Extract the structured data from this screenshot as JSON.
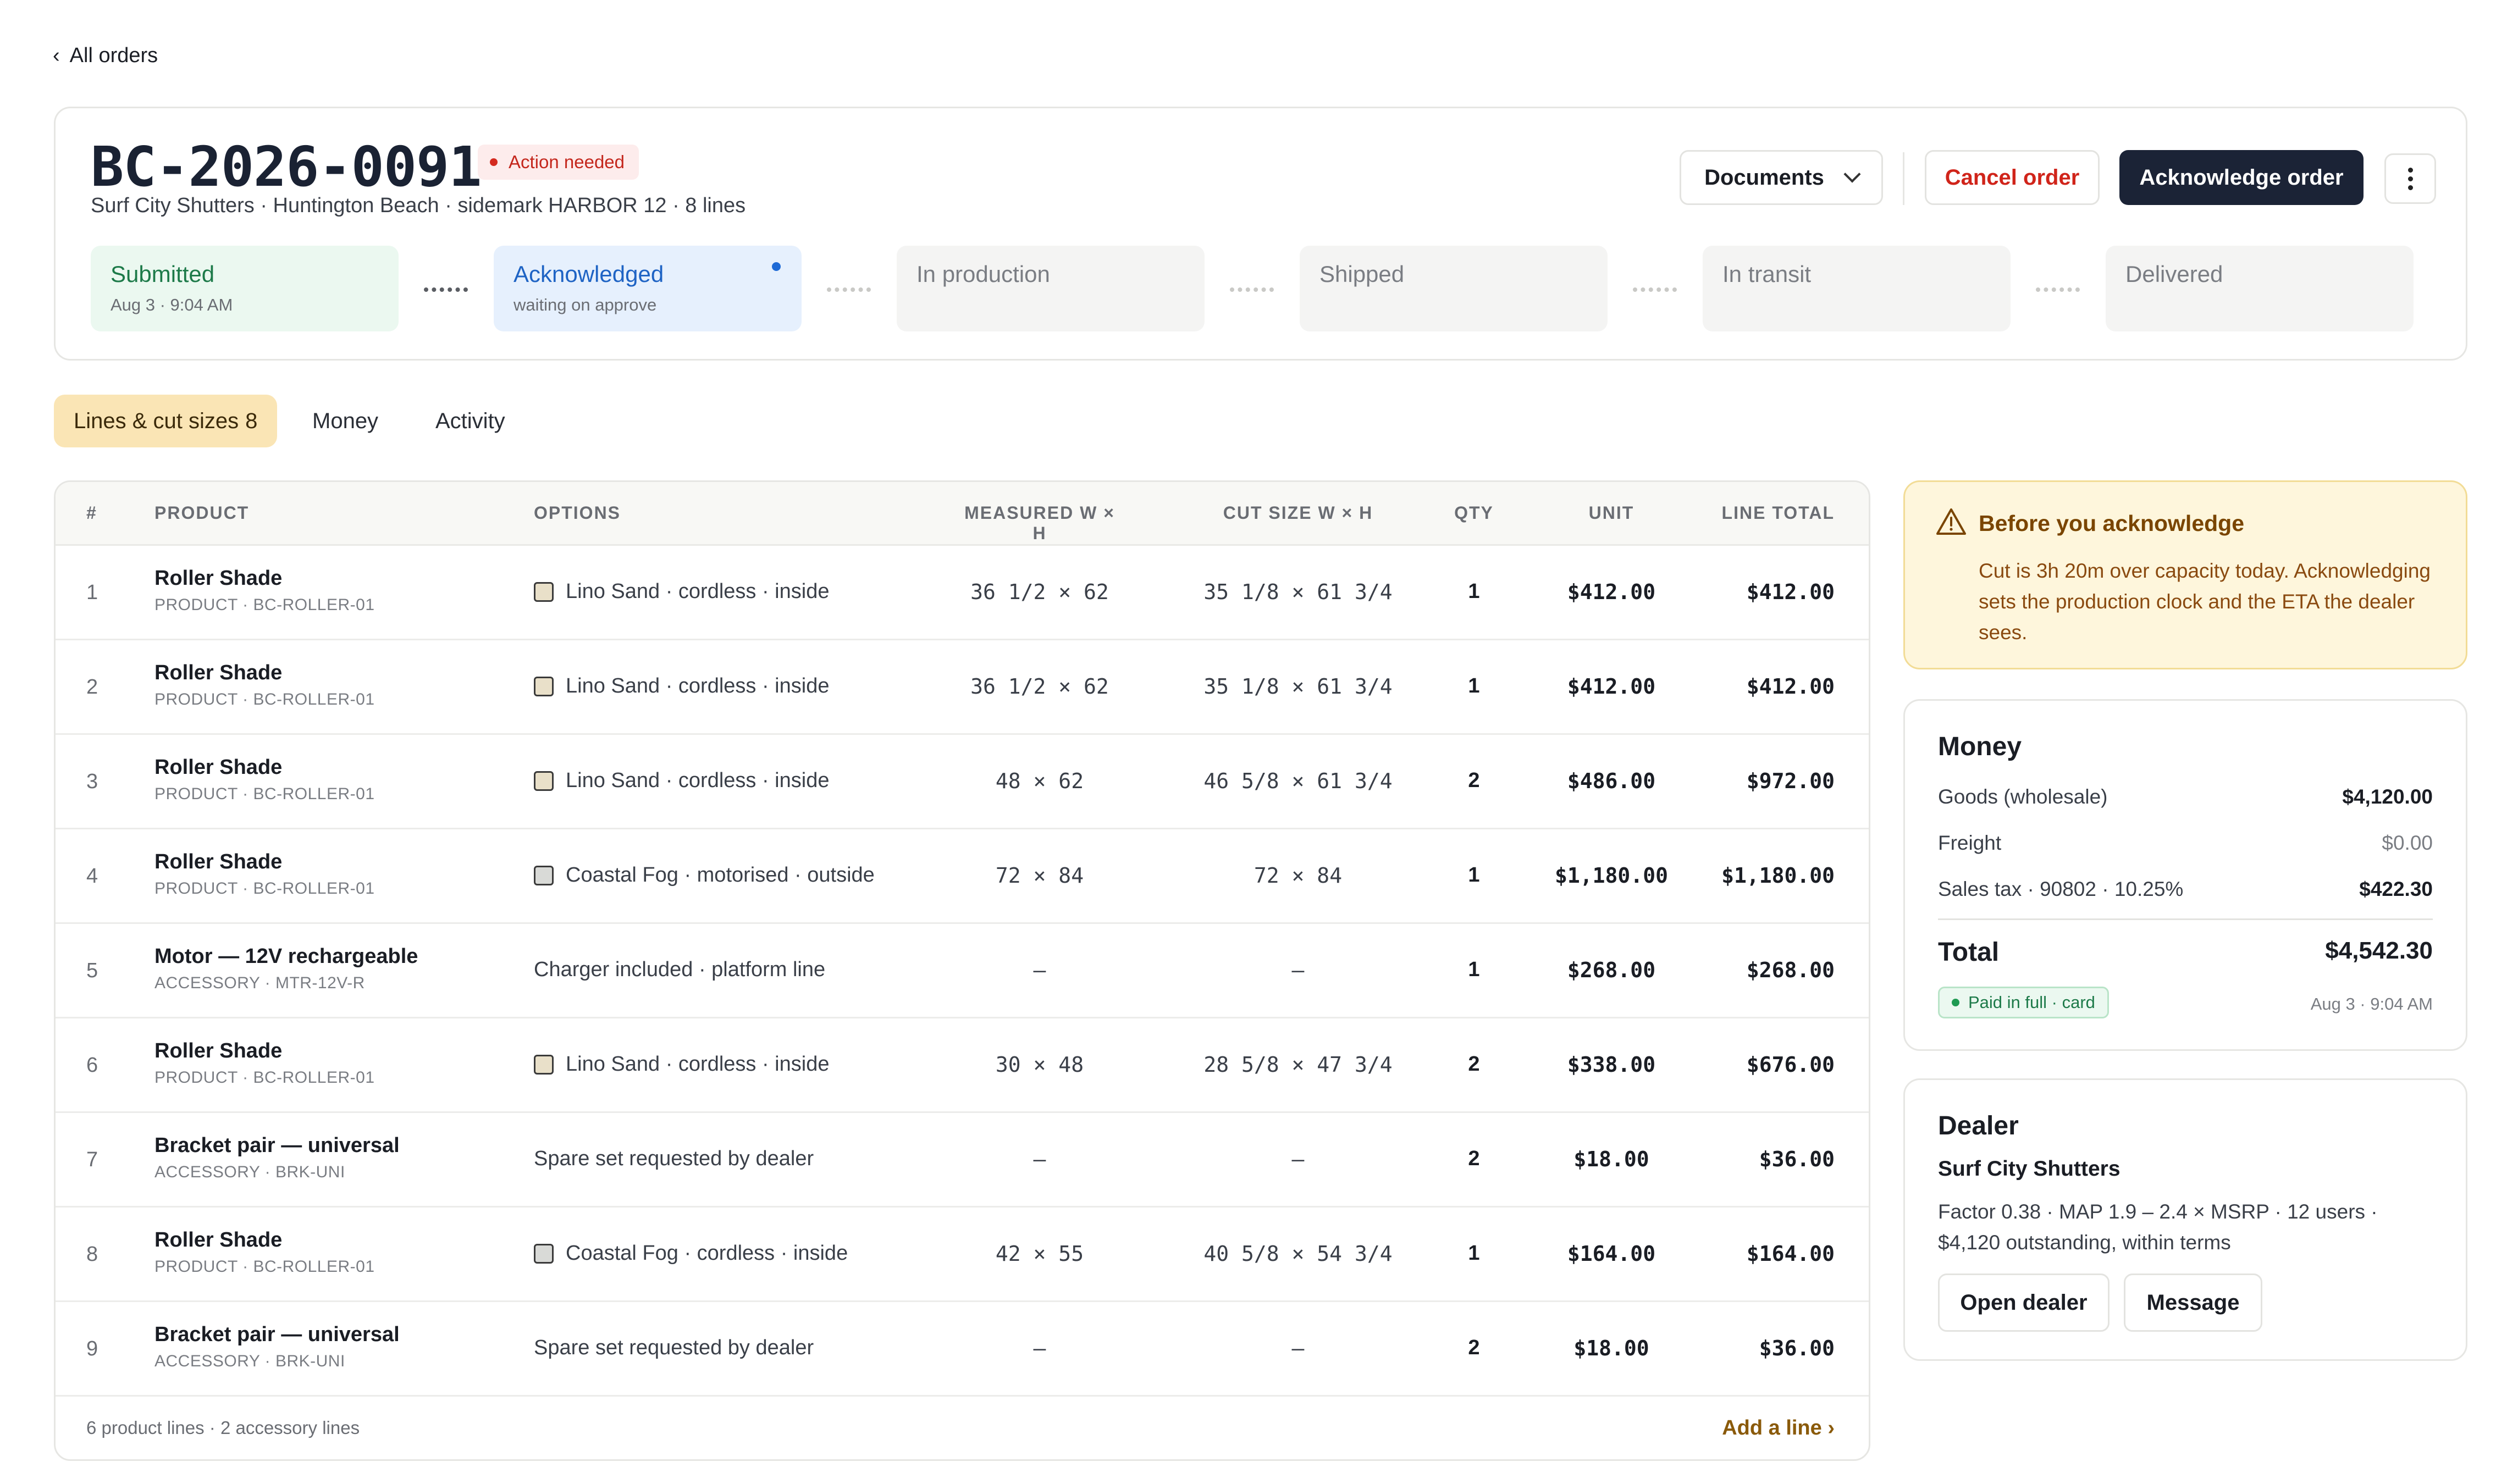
{
  "nav": {
    "back_label": "All orders"
  },
  "order": {
    "id": "BC-2026-0091",
    "status_badge": "Action needed",
    "subline": "Surf City Shutters · Huntington Beach · sidemark HARBOR 12 · 8 lines"
  },
  "actions": {
    "documents": "Documents",
    "cancel": "Cancel order",
    "acknowledge": "Acknowledge order"
  },
  "stepper": [
    {
      "label": "Submitted",
      "sub": "Aug 3 · 9:04 AM",
      "state": "done"
    },
    {
      "label": "Acknowledged",
      "sub": "waiting on approve",
      "state": "active"
    },
    {
      "label": "In production",
      "sub": "",
      "state": "pending"
    },
    {
      "label": "Shipped",
      "sub": "",
      "state": "pending"
    },
    {
      "label": "In transit",
      "sub": "",
      "state": "pending"
    },
    {
      "label": "Delivered",
      "sub": "",
      "state": "pending"
    }
  ],
  "tabs": [
    {
      "label": "Lines & cut sizes",
      "count": "8"
    },
    {
      "label": "Money",
      "count": ""
    },
    {
      "label": "Activity",
      "count": ""
    }
  ],
  "table": {
    "columns": [
      "#",
      "PRODUCT",
      "OPTIONS",
      "MEASURED W × H",
      "CUT SIZE W × H",
      "QTY",
      "UNIT",
      "LINE TOTAL"
    ],
    "rows": [
      {
        "num": "1",
        "name": "Roller Shade",
        "sku": "PRODUCT · BC-ROLLER-01",
        "options": "Lino Sand · cordless · inside",
        "swatch": "#e9e0c9",
        "measured": "36 1/2 × 62",
        "cut": "35 1/8 × 61 3/4",
        "qty": "1",
        "unit": "$412.00",
        "total": "$412.00"
      },
      {
        "num": "2",
        "name": "Roller Shade",
        "sku": "PRODUCT · BC-ROLLER-01",
        "options": "Lino Sand · cordless · inside",
        "swatch": "#e9e0c9",
        "measured": "36 1/2 × 62",
        "cut": "35 1/8 × 61 3/4",
        "qty": "1",
        "unit": "$412.00",
        "total": "$412.00"
      },
      {
        "num": "3",
        "name": "Roller Shade",
        "sku": "PRODUCT · BC-ROLLER-01",
        "options": "Lino Sand · cordless · inside",
        "swatch": "#e9e0c9",
        "measured": "48 × 62",
        "cut": "46 5/8 × 61 3/4",
        "qty": "2",
        "unit": "$486.00",
        "total": "$972.00"
      },
      {
        "num": "4",
        "name": "Roller Shade",
        "sku": "PRODUCT · BC-ROLLER-01",
        "options": "Coastal Fog · motorised · outside",
        "swatch": "#d9dad7",
        "measured": "72 × 84",
        "cut": "72 × 84",
        "qty": "1",
        "unit": "$1,180.00",
        "total": "$1,180.00"
      },
      {
        "num": "5",
        "name": "Motor — 12V rechargeable",
        "sku": "ACCESSORY · MTR-12V-R",
        "options": "Charger included · platform line",
        "swatch": "",
        "measured": "–",
        "cut": "–",
        "qty": "1",
        "unit": "$268.00",
        "total": "$268.00"
      },
      {
        "num": "6",
        "name": "Roller Shade",
        "sku": "PRODUCT · BC-ROLLER-01",
        "options": "Lino Sand · cordless · inside",
        "swatch": "#e9e0c9",
        "measured": "30 × 48",
        "cut": "28 5/8 × 47 3/4",
        "qty": "2",
        "unit": "$338.00",
        "total": "$676.00"
      },
      {
        "num": "7",
        "name": "Bracket pair — universal",
        "sku": "ACCESSORY · BRK-UNI",
        "options": "Spare set requested by dealer",
        "swatch": "",
        "measured": "–",
        "cut": "–",
        "qty": "2",
        "unit": "$18.00",
        "total": "$36.00"
      },
      {
        "num": "8",
        "name": "Roller Shade",
        "sku": "PRODUCT · BC-ROLLER-01",
        "options": "Coastal Fog · cordless · inside",
        "swatch": "#d9dad7",
        "measured": "42 × 55",
        "cut": "40 5/8 × 54 3/4",
        "qty": "1",
        "unit": "$164.00",
        "total": "$164.00"
      },
      {
        "num": "9",
        "name": "Bracket pair — universal",
        "sku": "ACCESSORY · BRK-UNI",
        "options": "Spare set requested by dealer",
        "swatch": "",
        "measured": "–",
        "cut": "–",
        "qty": "2",
        "unit": "$18.00",
        "total": "$36.00"
      }
    ],
    "footer_summary": "6 product lines · 2 accessory lines",
    "add_line": "Add a line ›"
  },
  "warning": {
    "title": "Before you acknowledge",
    "body": "Cut is 3h 20m over capacity today. Acknowledging sets the production clock and the ETA the dealer sees."
  },
  "money": {
    "title": "Money",
    "lines": [
      {
        "label": "Goods (wholesale)",
        "value": "$4,120.00",
        "style": "bold"
      },
      {
        "label": "Freight",
        "value": "$0.00",
        "style": "mute"
      },
      {
        "label": "Sales tax · 90802 · 10.25%",
        "value": "$422.30",
        "style": "bold"
      }
    ],
    "total_label": "Total",
    "total_value": "$4,542.30",
    "paid_badge": "Paid in full · card",
    "paid_time": "Aug 3 · 9:04 AM"
  },
  "dealer": {
    "title": "Dealer",
    "name": "Surf City Shutters",
    "info": "Factor 0.38 · MAP 1.9 – 2.4 × MSRP · 12 users · $4,120 outstanding, within terms",
    "open_button": "Open dealer",
    "message_button": "Message"
  },
  "colors": {
    "primary": "#1b2336",
    "danger": "#d0241a",
    "success": "#1d7a49",
    "info": "#1e63c4",
    "tab_active": "#fae5b5",
    "warning_bg": "#fef6dc"
  },
  "icons": {
    "back": "chevron-left-icon",
    "documents": "chevron-down-icon",
    "more": "more-vertical-icon",
    "warning": "warning-triangle-icon"
  }
}
